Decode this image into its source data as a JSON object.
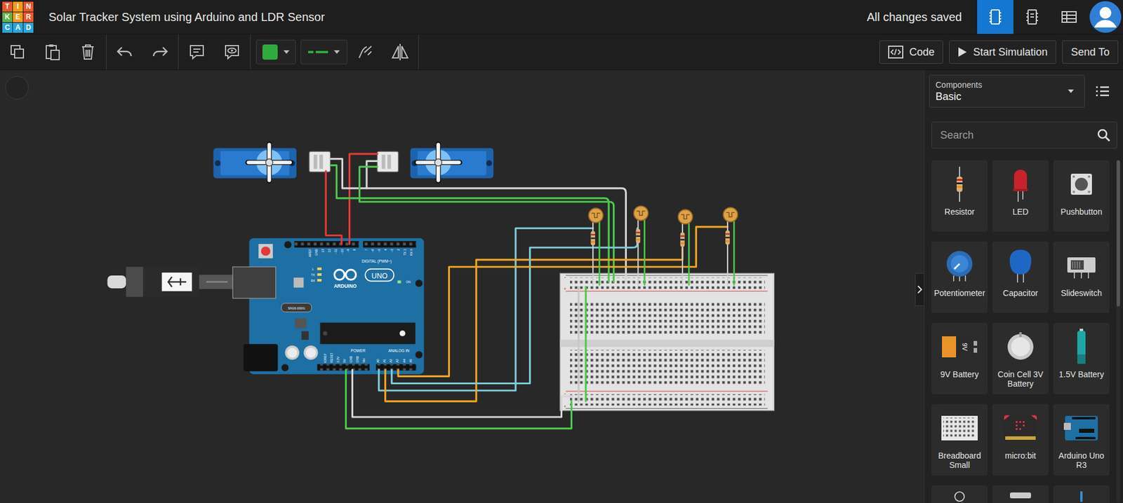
{
  "header": {
    "logo": [
      "T",
      "I",
      "N",
      "K",
      "E",
      "R",
      "C",
      "A",
      "D"
    ],
    "title": "Solar Tracker System using Arduino and LDR Sensor",
    "status": "All changes saved",
    "views": [
      {
        "name": "circuit",
        "selected": true
      },
      {
        "name": "schematic",
        "selected": false
      },
      {
        "name": "component-list",
        "selected": false
      }
    ]
  },
  "toolbar": {
    "wire_color": "#2faa3f",
    "buttons": [
      "Code",
      "Start Simulation",
      "Send To"
    ]
  },
  "panel": {
    "category_label": "Components",
    "category": "Basic",
    "search_placeholder": "Search",
    "components": [
      {
        "label": "Resistor",
        "kind": "resistor"
      },
      {
        "label": "LED",
        "kind": "led"
      },
      {
        "label": "Pushbutton",
        "kind": "pushbutton"
      },
      {
        "label": "Potentiometer",
        "kind": "potentiometer"
      },
      {
        "label": "Capacitor",
        "kind": "capacitor"
      },
      {
        "label": "Slideswitch",
        "kind": "slideswitch"
      },
      {
        "label": "9V Battery",
        "kind": "battery9v",
        "icon_text": "9V"
      },
      {
        "label": "Coin Cell 3V Battery",
        "kind": "coincell"
      },
      {
        "label": "1.5V Battery",
        "kind": "battery15"
      },
      {
        "label": "Breadboard Small",
        "kind": "breadboard"
      },
      {
        "label": "micro:bit",
        "kind": "microbit"
      },
      {
        "label": "Arduino Uno R3",
        "kind": "arduino"
      }
    ]
  },
  "circuit": {
    "arduino": {
      "digital_label": "DIGITAL (PWM~)",
      "brand": "ARDUINO",
      "model": "UNO",
      "power_label": "POWER",
      "analog_label": "ANALOG IN",
      "crystal": "SN16.000G",
      "on_label": "ON",
      "leds": [
        "L",
        "TX",
        "RX"
      ],
      "digital_pins": [
        "AREF",
        "GND",
        "13",
        "12",
        "~11",
        "~10",
        "~9",
        "8",
        "7",
        "~6",
        "~5",
        "4",
        "~3",
        "2",
        "TX 1",
        "RX 0"
      ],
      "power_pins": [
        "IOREF",
        "RESET",
        "3.3V",
        "5V",
        "GND",
        "GND",
        "Vin"
      ],
      "analog_pins": [
        "A0",
        "A1",
        "A2",
        "A3",
        "A4",
        "A5"
      ]
    },
    "breadboard": {
      "rail_marks": [
        "-",
        "+",
        "-",
        "+"
      ]
    }
  }
}
